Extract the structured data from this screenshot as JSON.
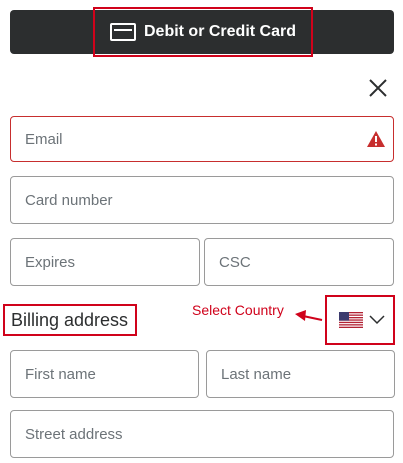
{
  "payment": {
    "button_label": "Debit or Credit Card"
  },
  "icons": {
    "card": "card-icon",
    "close": "close-icon",
    "warning": "warning-icon",
    "flag": "us-flag-icon",
    "chevron": "chevron-down-icon"
  },
  "form": {
    "email_placeholder": "Email",
    "card_number_placeholder": "Card number",
    "expires_placeholder": "Expires",
    "csc_placeholder": "CSC",
    "first_name_placeholder": "First name",
    "last_name_placeholder": "Last name",
    "street_placeholder": "Street address"
  },
  "billing": {
    "heading": "Billing address"
  },
  "annotation": {
    "select_country": "Select Country"
  },
  "colors": {
    "accent_red": "#d0021b",
    "error_border": "#c72e2e",
    "bar": "#2c2e2f"
  }
}
